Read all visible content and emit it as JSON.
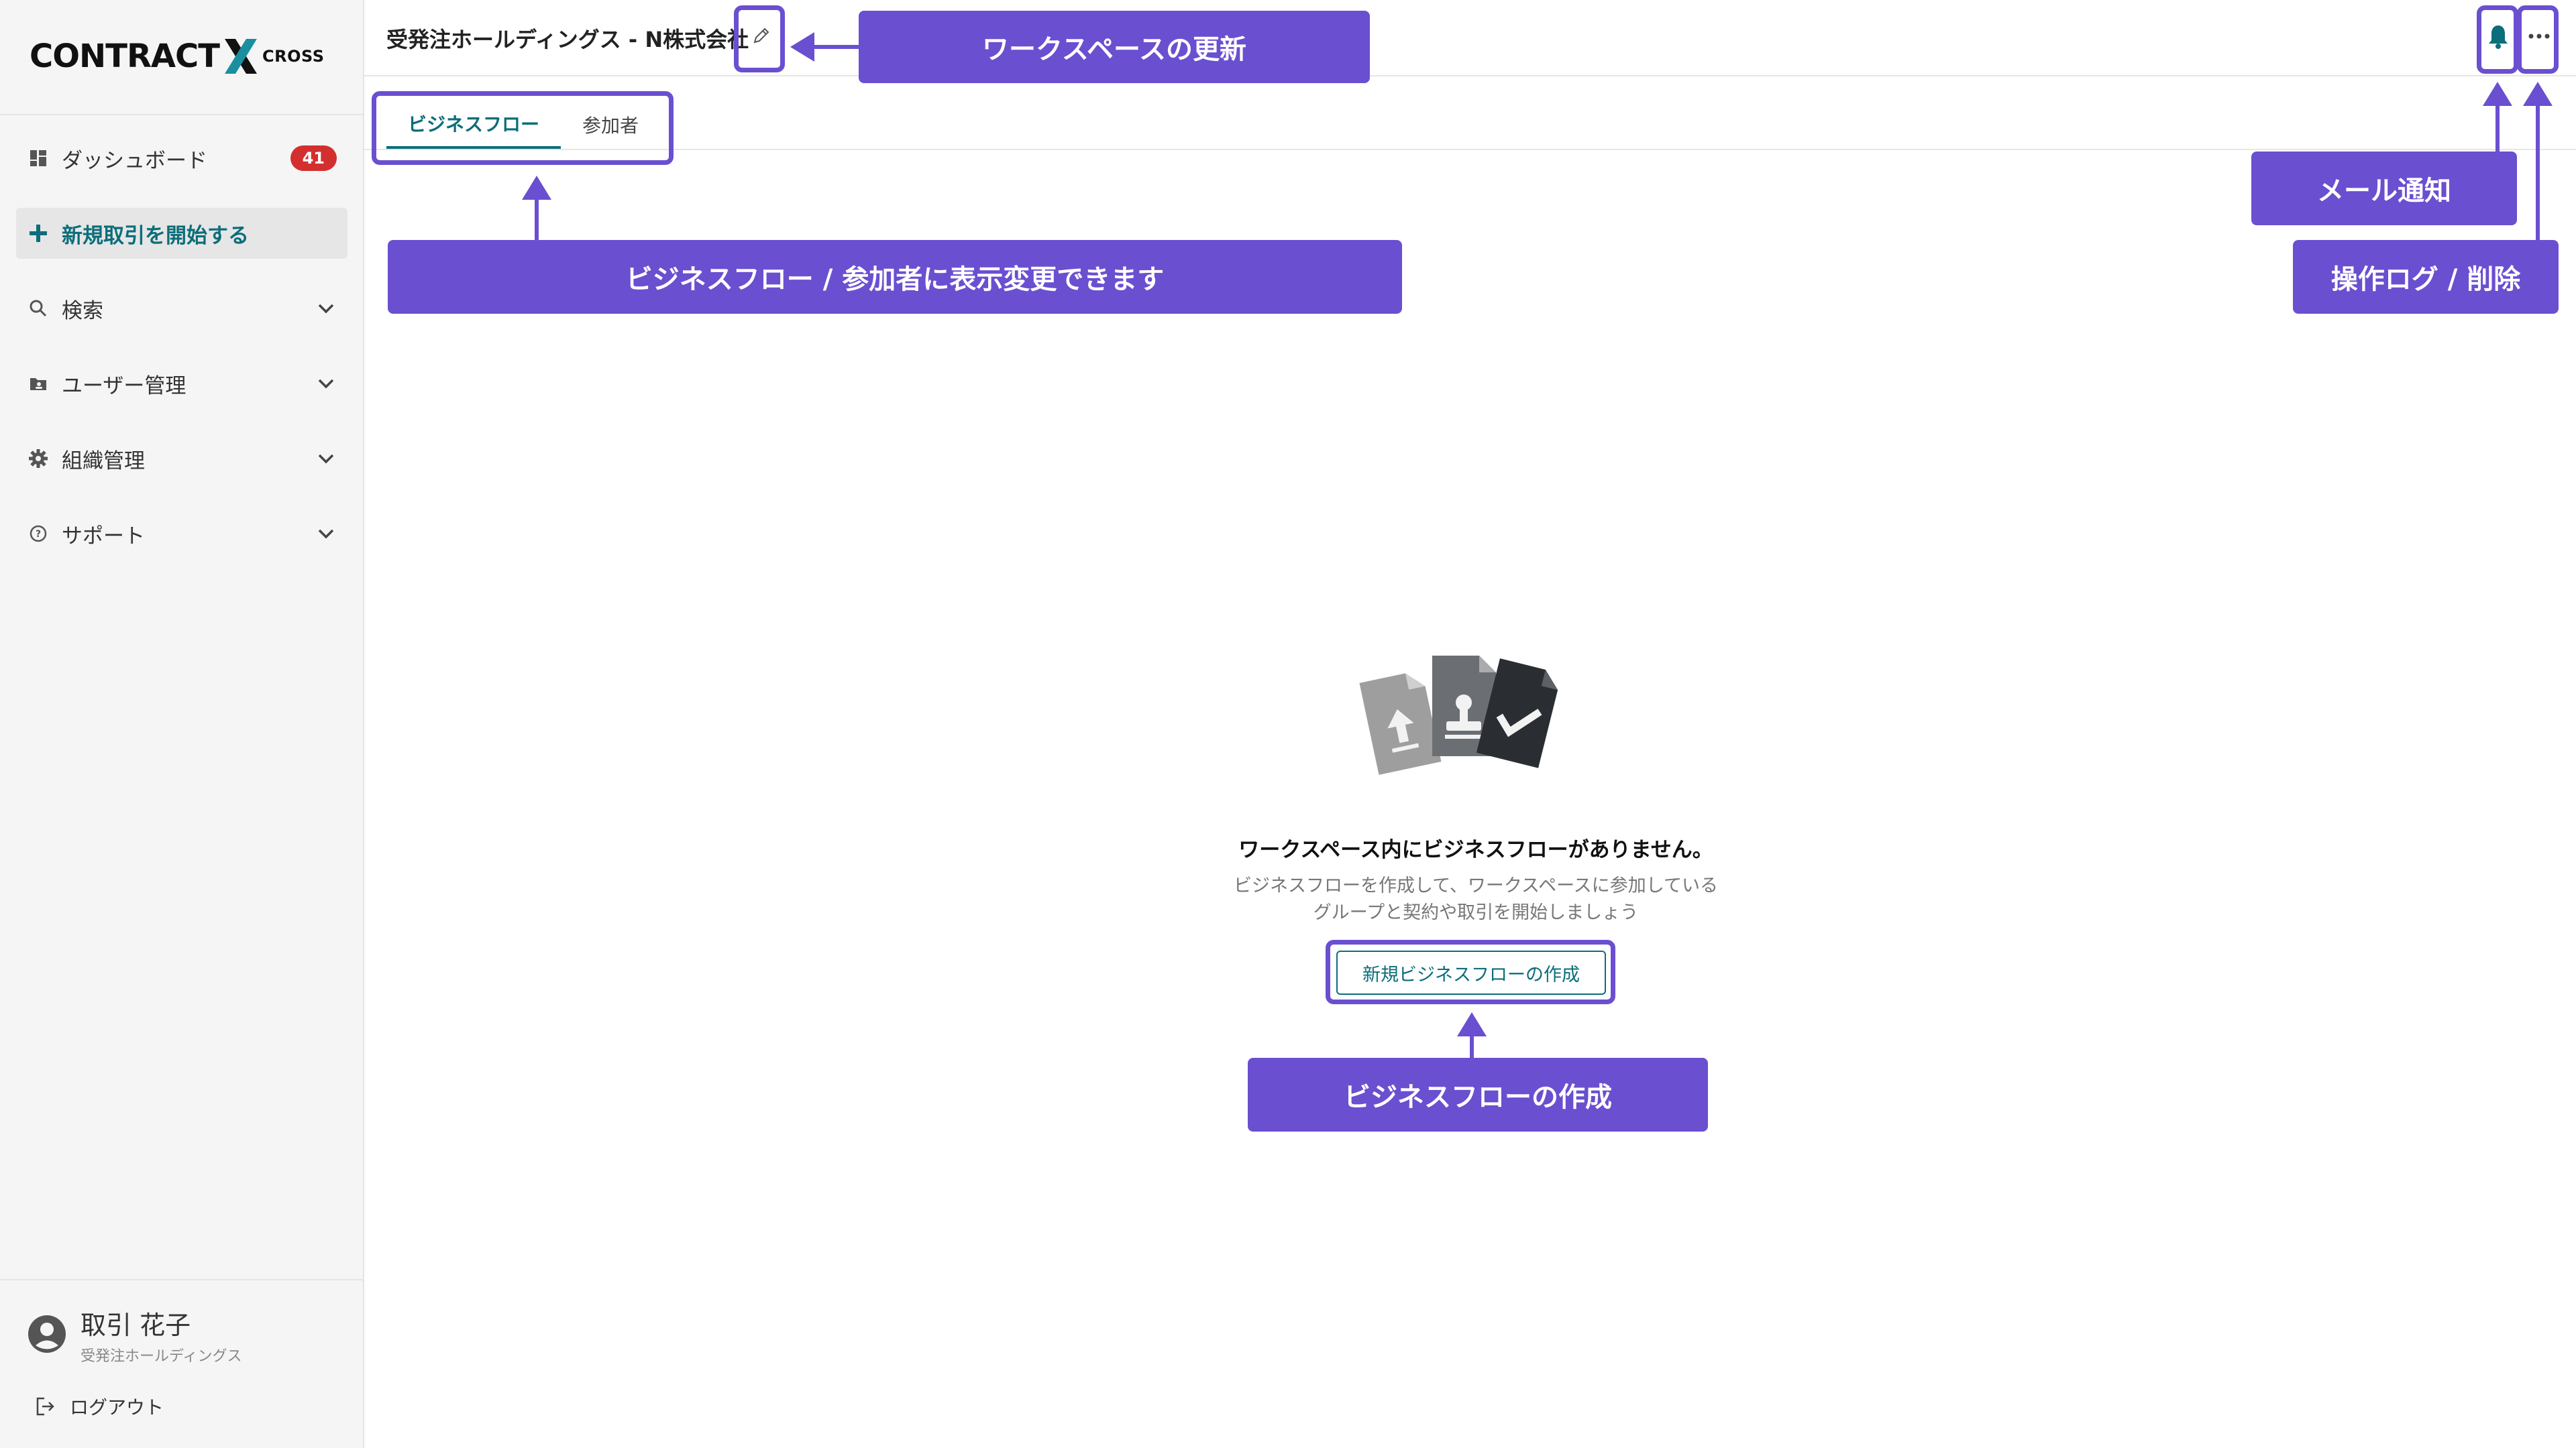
{
  "brand": {
    "logo_word1": "CONTRACT",
    "logo_word2": "CROSS",
    "accent_color": "#0b6e7a",
    "annotation_color": "#6a4fd0"
  },
  "sidebar": {
    "items": [
      {
        "label": "ダッシュボード",
        "icon": "dashboard-icon",
        "badge": "41"
      },
      {
        "label": "新規取引を開始する",
        "icon": "plus-icon"
      },
      {
        "label": "検索",
        "icon": "search-icon"
      },
      {
        "label": "ユーザー管理",
        "icon": "folder-user-icon"
      },
      {
        "label": "組織管理",
        "icon": "gear-icon"
      },
      {
        "label": "サポート",
        "icon": "help-circle-icon"
      }
    ],
    "user": {
      "name": "取引 花子",
      "org": "受発注ホールディングス"
    },
    "logout_label": "ログアウト"
  },
  "header": {
    "workspace_title": "受発注ホールディングス - N株式会社"
  },
  "tabs": [
    {
      "label": "ビジネスフロー",
      "active": true
    },
    {
      "label": "参加者",
      "active": false
    }
  ],
  "empty_state": {
    "title": "ワークスペース内にビジネスフローがありません。",
    "desc_line1": "ビジネスフローを作成して、ワークスペースに参加している",
    "desc_line2": "グループと契約や取引を開始しましょう",
    "button_label": "新規ビジネスフローの作成"
  },
  "annotations": {
    "workspace_update": "ワークスペースの更新",
    "tabs_switch": "ビジネスフロー / 参加者に表示変更できます",
    "mail_notification": "メール通知",
    "log_delete": "操作ログ / 削除",
    "create_flow": "ビジネスフローの作成"
  }
}
